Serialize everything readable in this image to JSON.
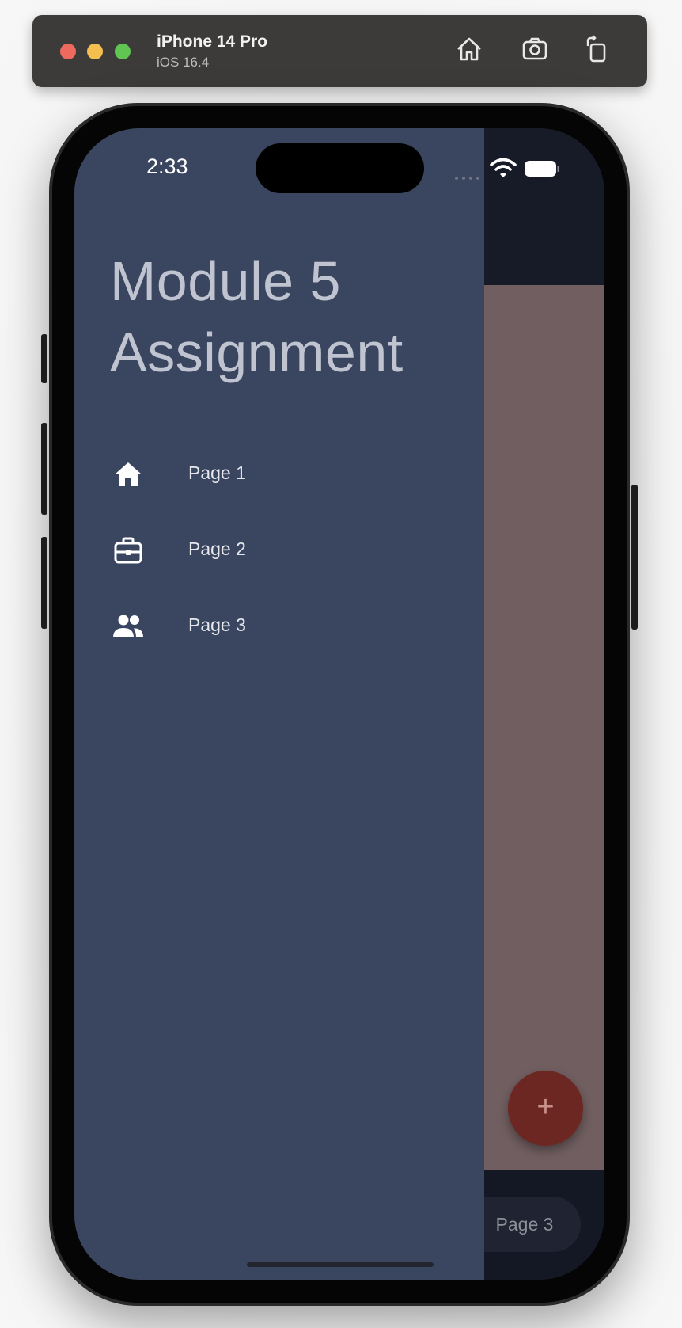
{
  "simulator": {
    "device_name": "iPhone 14 Pro",
    "os_version": "iOS 16.4",
    "buttons": [
      "home-icon",
      "screenshot-icon",
      "rotate-icon"
    ]
  },
  "status_bar": {
    "time": "2:33"
  },
  "drawer": {
    "title_line1": "Module 5",
    "title_line2": "Assignment",
    "items": [
      {
        "label": "Page 1",
        "icon": "home-icon"
      },
      {
        "label": "Page 2",
        "icon": "briefcase-icon"
      },
      {
        "label": "Page 3",
        "icon": "people-icon"
      }
    ]
  },
  "bottom_nav": {
    "selected_label": "Page 3"
  },
  "fab": {
    "symbol": "+"
  },
  "colors": {
    "drawer_bg": "#3a4560",
    "app_bar_bg": "#171b27",
    "body_bg": "#705e60",
    "fab_bg": "#6c2722"
  }
}
